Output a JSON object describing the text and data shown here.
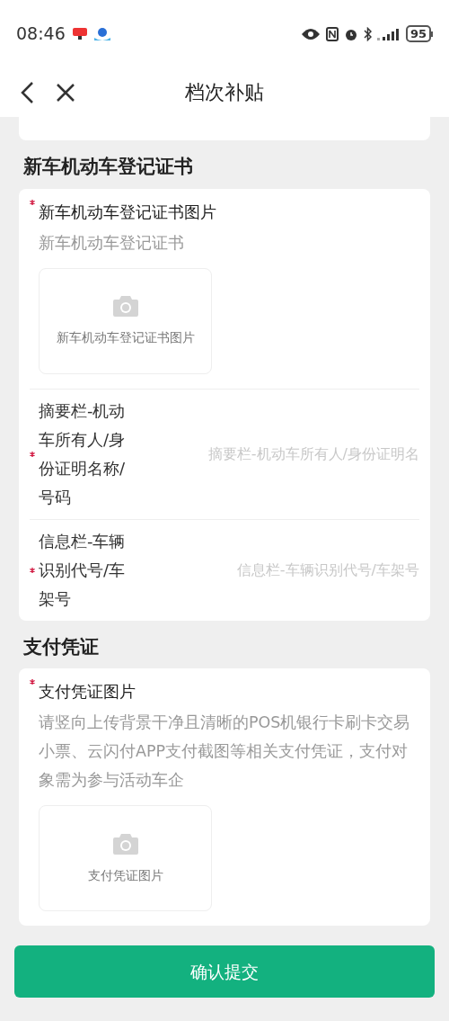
{
  "status_bar": {
    "time": "08:46",
    "battery": "95"
  },
  "header": {
    "title": "档次补贴"
  },
  "sections": [
    {
      "title": "新车机动车登记证书",
      "fields": [
        {
          "kind": "upload",
          "required": true,
          "label": "新车机动车登记证书图片",
          "hint": "新车机动车登记证书",
          "upload_label": "新车机动车登记证书图片"
        },
        {
          "kind": "input",
          "required": true,
          "label": "摘要栏-机动车所有人/身份证明名称/号码",
          "placeholder": "摘要栏-机动车所有人/身份证明名"
        },
        {
          "kind": "input",
          "required": true,
          "label": "信息栏-车辆识别代号/车架号",
          "placeholder": "信息栏-车辆识别代号/车架号"
        }
      ]
    },
    {
      "title": "支付凭证",
      "fields": [
        {
          "kind": "upload",
          "required": true,
          "label": "支付凭证图片",
          "hint": "请竖向上传背景干净且清晰的POS机银行卡刷卡交易小票、云闪付APP支付截图等相关支付凭证，支付对象需为参与活动车企",
          "upload_label": "支付凭证图片"
        }
      ]
    }
  ],
  "submit_button": "确认提交"
}
